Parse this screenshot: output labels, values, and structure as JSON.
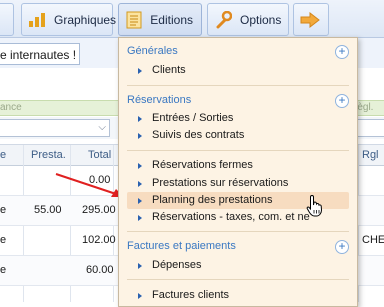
{
  "toolbar": {
    "graphiques_label": "Graphiques",
    "editions_label": "Editions",
    "options_label": "Options"
  },
  "notice": {
    "text": "e internautes !"
  },
  "green_bar": {
    "left_text": "ance",
    "right_text": "règl."
  },
  "table": {
    "headers": {
      "col1": "e",
      "presta": "Presta.",
      "total": "Total",
      "rgl": "Rgl"
    },
    "rows": [
      {
        "c1": "",
        "presta": "",
        "total": "0.00",
        "rgl": ""
      },
      {
        "c1": "e",
        "presta": "55.00",
        "total": "295.00",
        "rgl": ""
      },
      {
        "c1": "e",
        "presta": "",
        "total": "102.00",
        "rgl": "CHEQ"
      },
      {
        "c1": "e",
        "presta": "",
        "total": "60.00",
        "rgl": ""
      }
    ]
  },
  "menu": {
    "sections": {
      "generales": "Générales",
      "reservations": "Réservations",
      "factures": "Factures et paiements"
    },
    "items": {
      "clients": "Clients",
      "entrees_sorties": "Entrées / Sorties",
      "suivis_contrats": "Suivis des contrats",
      "reservations_fermes": "Réservations fermes",
      "prestations_sur_reservations": "Prestations sur réservations",
      "planning_prestations": "Planning des prestations",
      "reservations_taxes": "Réservations - taxes, com. et ne",
      "depenses": "Dépenses",
      "factures_clients": "Factures clients"
    }
  },
  "colors": {
    "accent": "#3a78c2",
    "menu_bg": "#fdf3e4",
    "hover": "#f7dcc0",
    "arrow": "#e02020"
  }
}
